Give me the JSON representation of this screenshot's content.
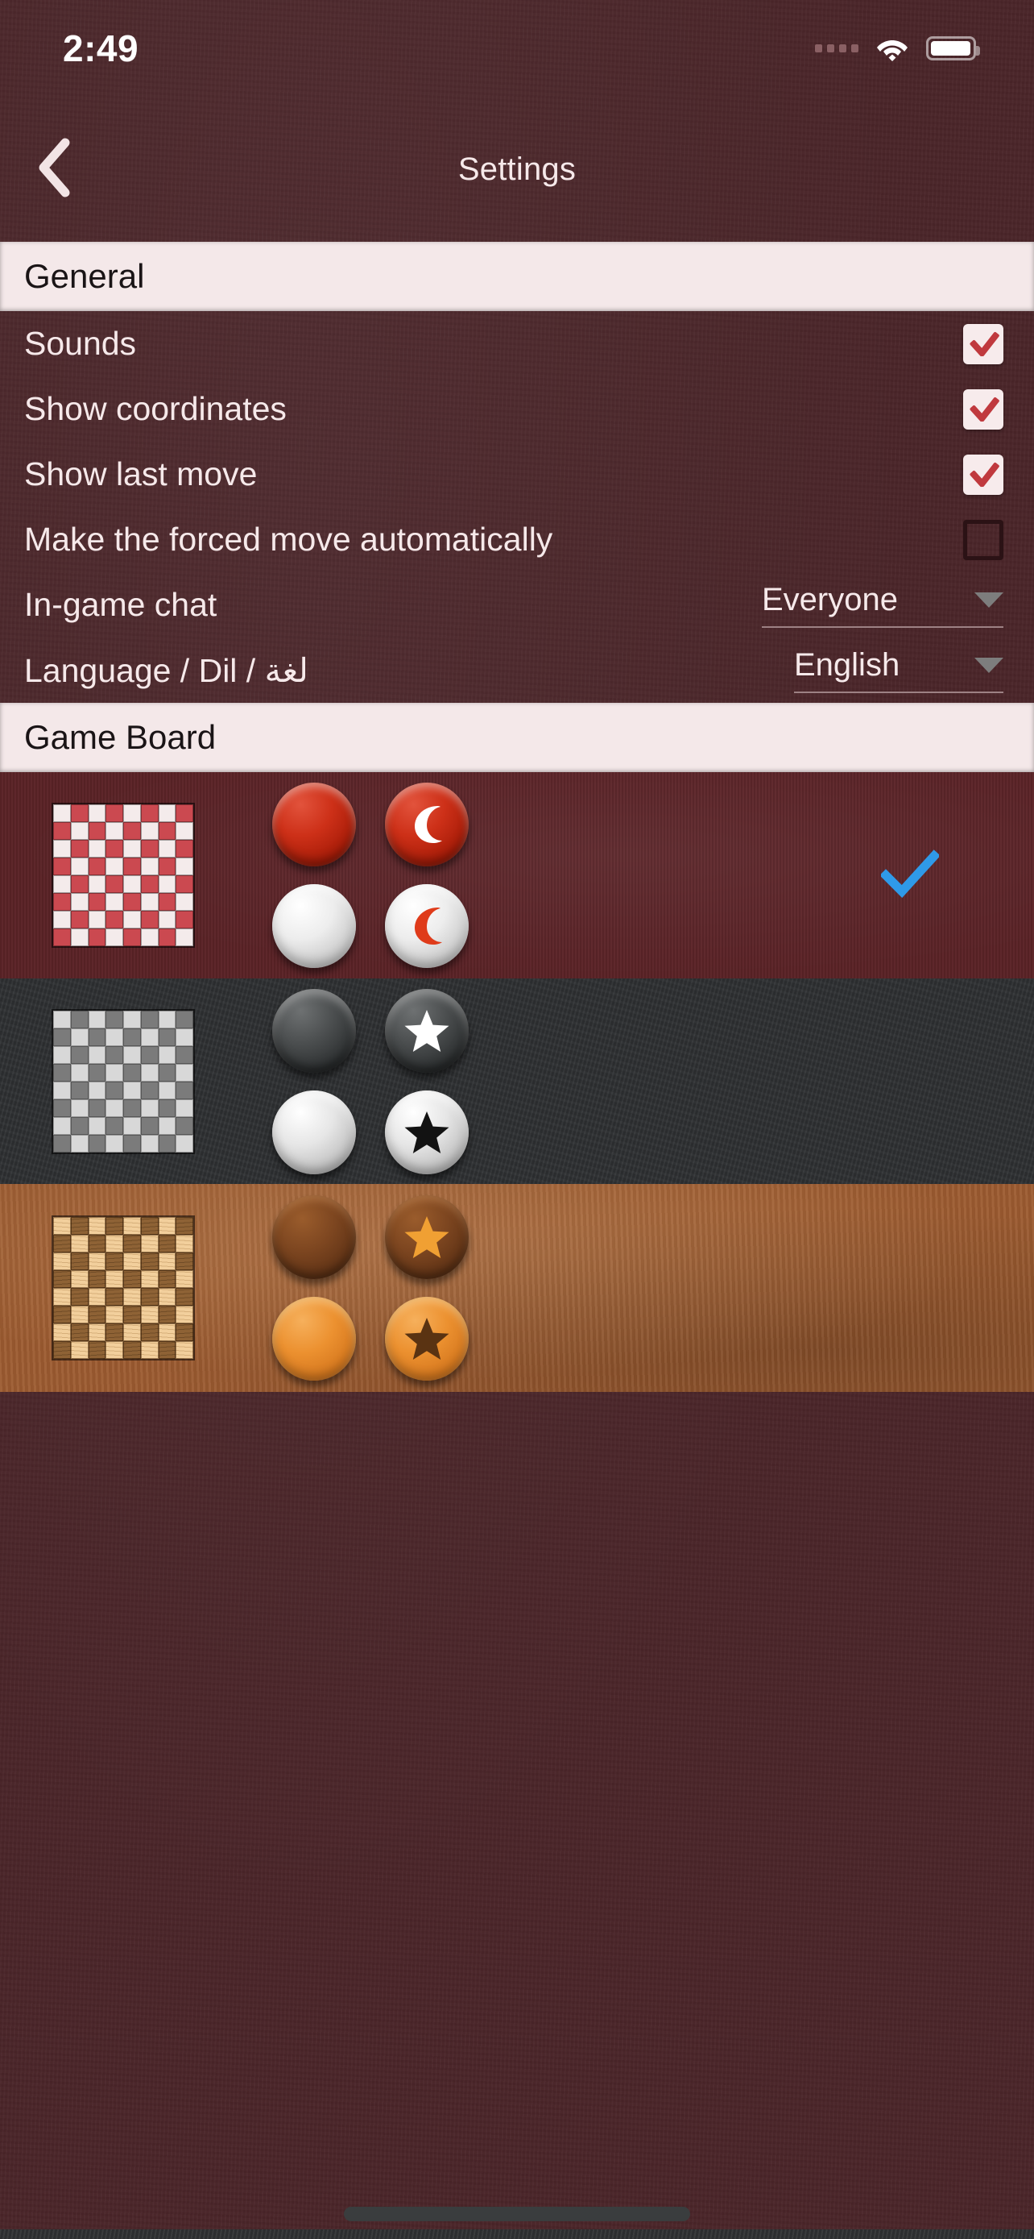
{
  "status_bar": {
    "time": "2:49",
    "cellular_icon": "cellular-dots-icon",
    "wifi_icon": "wifi-icon",
    "battery_icon": "battery-icon"
  },
  "nav_bar": {
    "back_icon": "chevron-left-icon",
    "title": "Settings"
  },
  "sections": [
    {
      "id": "general",
      "title": "General"
    },
    {
      "id": "game_board",
      "title": "Game Board"
    }
  ],
  "general_rows": [
    {
      "label": "Sounds",
      "control": "checkbox",
      "checked": true
    },
    {
      "label": "Show coordinates",
      "control": "checkbox",
      "checked": true
    },
    {
      "label": "Show last move",
      "control": "checkbox",
      "checked": true
    },
    {
      "label": "Make the forced move automatically",
      "control": "checkbox",
      "checked": false
    },
    {
      "label": "In-game chat",
      "control": "dropdown",
      "value": "Everyone"
    },
    {
      "label": "Language / Dil / لغة",
      "control": "dropdown",
      "value": "English"
    }
  ],
  "board_themes": [
    {
      "id": "red",
      "name": "red-board-theme",
      "selected": true,
      "board_light_color": "#f4ebeb",
      "board_dark_color": "#cb4950",
      "background_color": "#5b2327",
      "pieces": [
        {
          "name": "red-piece",
          "glyph": "none"
        },
        {
          "name": "red-king-piece",
          "glyph": "crescent-moon-icon"
        },
        {
          "name": "white-piece",
          "glyph": "none"
        },
        {
          "name": "white-king-piece",
          "glyph": "crescent-moon-icon"
        }
      ]
    },
    {
      "id": "grey",
      "name": "grey-board-theme",
      "selected": false,
      "board_light_color": "#d8d8d8",
      "board_dark_color": "#7b7b7b",
      "background_color": "#2f3133",
      "pieces": [
        {
          "name": "dark-metal-piece",
          "glyph": "none"
        },
        {
          "name": "dark-metal-king-piece",
          "glyph": "star-icon"
        },
        {
          "name": "light-metal-piece",
          "glyph": "none"
        },
        {
          "name": "light-metal-king-piece",
          "glyph": "star-icon"
        }
      ]
    },
    {
      "id": "wood",
      "name": "wood-board-theme",
      "selected": false,
      "board_light_color": "#f2cf9c",
      "board_dark_color": "#8e6235",
      "background_color": "#9c5b30",
      "pieces": [
        {
          "name": "dark-wood-piece",
          "glyph": "none"
        },
        {
          "name": "dark-wood-king-piece",
          "glyph": "star-icon"
        },
        {
          "name": "light-wood-piece",
          "glyph": "none"
        },
        {
          "name": "light-wood-king-piece",
          "glyph": "star-icon"
        }
      ]
    }
  ],
  "colors": {
    "background_maroon": "#4a2529",
    "section_header_bg": "#f4e8e9",
    "text_light": "#f6e9ea",
    "checkbox_check": "#c0393e",
    "selection_check": "#2f9ae8"
  },
  "selection_icon": "blue-checkmark-icon",
  "home_indicator": "home-indicator"
}
